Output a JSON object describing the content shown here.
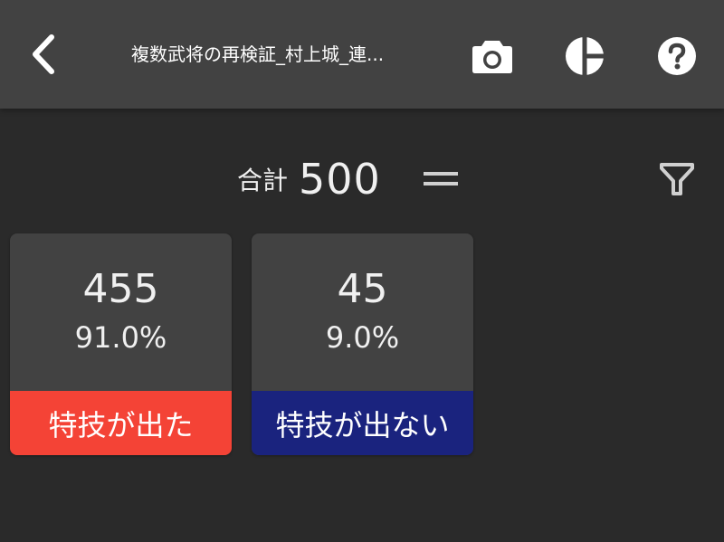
{
  "header": {
    "title": "複数武将の再検証_村上城_連...",
    "back_icon": "chevron-left-icon",
    "camera_icon": "camera-icon",
    "chart_icon": "pie-chart-icon",
    "help_icon": "help-icon"
  },
  "summary": {
    "total_label": "合計",
    "total_value": "500",
    "equals_icon": "equals-icon",
    "filter_icon": "filter-icon"
  },
  "cards": [
    {
      "count": "455",
      "percent": "91.0%",
      "label": "特技が出た",
      "color": "#f44336"
    },
    {
      "count": "45",
      "percent": "9.0%",
      "label": "特技が出ない",
      "color": "#1a237e"
    }
  ],
  "colors": {
    "background": "#2a2a2a",
    "surface": "#424242",
    "text": "#ffffff"
  }
}
